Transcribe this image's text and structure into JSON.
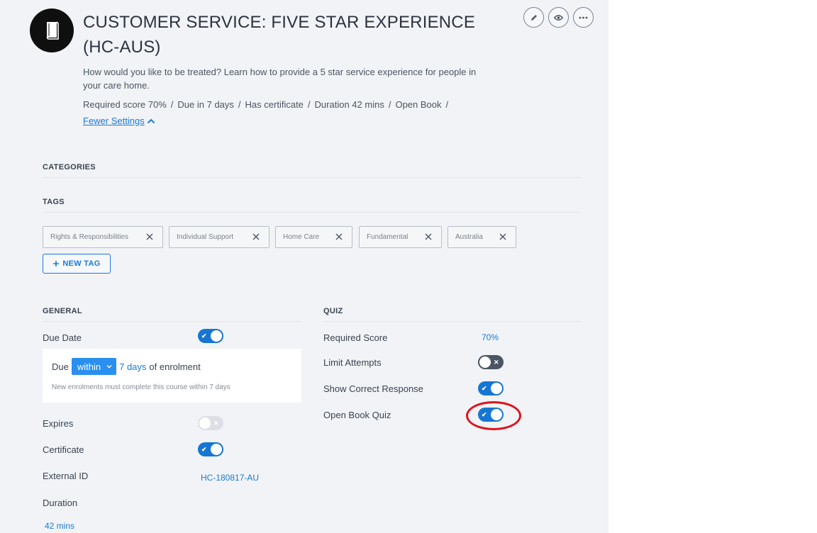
{
  "course": {
    "title": "CUSTOMER SERVICE: FIVE STAR EXPERIENCE (HC-AUS)",
    "description": "How would you like to be treated? Learn how to provide a 5 star service experience for people in your care home.",
    "meta": [
      "Required score 70%",
      "Due in 7 days",
      "Has certificate",
      "Duration 42 mins",
      "Open Book"
    ],
    "meta_separator": "/",
    "fewer_settings_label": "Fewer Settings"
  },
  "actions": [
    {
      "icon": "pencil-icon"
    },
    {
      "icon": "eye-icon"
    },
    {
      "icon": "more-icon"
    }
  ],
  "sections": {
    "categories": "CATEGORIES",
    "tags": "TAGS",
    "general": "GENERAL",
    "quiz": "QUIZ"
  },
  "tags": [
    "Rights & Responsibilities",
    "Individual Support",
    "Home Care",
    "Fundamental",
    "Australia"
  ],
  "new_tag_label": "NEW TAG",
  "general": {
    "due_date_label": "Due Date",
    "due_date_on": true,
    "due_prefix": "Due",
    "due_mode": "within",
    "due_days": "7 days",
    "due_suffix": "of enrolment",
    "due_note": "New enrolments must complete this course within 7 days",
    "expires_label": "Expires",
    "expires_on": false,
    "certificate_label": "Certificate",
    "certificate_on": true,
    "external_id_label": "External ID",
    "external_id_value": "HC-180817-AU",
    "duration_label": "Duration",
    "duration_value": "42 mins"
  },
  "quiz": {
    "required_score_label": "Required Score",
    "required_score_value": "70%",
    "limit_attempts_label": "Limit Attempts",
    "limit_attempts_on": false,
    "show_correct_label": "Show Correct Response",
    "show_correct_on": true,
    "open_book_label": "Open Book Quiz",
    "open_book_on": true
  },
  "colors": {
    "accent": "#1776d2",
    "link": "#1a7ad8",
    "annotation": "#e0121b",
    "panel_bg": "#f1f3f6"
  }
}
